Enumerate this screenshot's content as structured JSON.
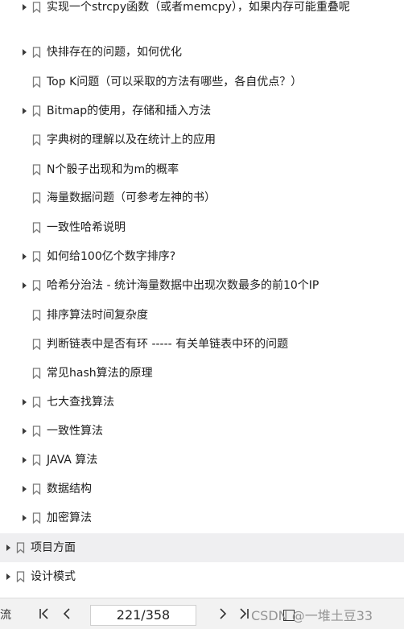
{
  "outline": {
    "items": [
      {
        "label": "实现一个strcpy函数（或者memcpy），如果内存可能重叠呢",
        "expandable": true,
        "level": 2
      },
      {
        "label": "快排存在的问题，如何优化",
        "expandable": true,
        "level": 2
      },
      {
        "label": "Top K问题（可以采取的方法有哪些，各自优点？）",
        "expandable": false,
        "level": 2
      },
      {
        "label": "Bitmap的使用，存储和插入方法",
        "expandable": true,
        "level": 2
      },
      {
        "label": "字典树的理解以及在统计上的应用",
        "expandable": false,
        "level": 2
      },
      {
        "label": "N个骰子出现和为m的概率",
        "expandable": false,
        "level": 2
      },
      {
        "label": "海量数据问题（可参考左神的书）",
        "expandable": false,
        "level": 2
      },
      {
        "label": "一致性哈希说明",
        "expandable": false,
        "level": 2
      },
      {
        "label": "如何给100亿个数字排序?",
        "expandable": true,
        "level": 2
      },
      {
        "label": "哈希分治法 - 统计海量数据中出现次数最多的前10个IP",
        "expandable": true,
        "level": 2
      },
      {
        "label": "排序算法时间复杂度",
        "expandable": false,
        "level": 2
      },
      {
        "label": "判断链表中是否有环 ----- 有关单链表中环的问题",
        "expandable": false,
        "level": 2
      },
      {
        "label": "常见hash算法的原理",
        "expandable": false,
        "level": 2
      },
      {
        "label": "七大查找算法",
        "expandable": true,
        "level": 2
      },
      {
        "label": "一致性算法",
        "expandable": true,
        "level": 2
      },
      {
        "label": "JAVA 算法",
        "expandable": true,
        "level": 2
      },
      {
        "label": "数据结构",
        "expandable": true,
        "level": 2
      },
      {
        "label": "加密算法",
        "expandable": true,
        "level": 2
      },
      {
        "label": "项目方面",
        "expandable": true,
        "level": 1,
        "selected": true
      },
      {
        "label": "设计模式",
        "expandable": true,
        "level": 1
      }
    ]
  },
  "bottombar": {
    "left_fragment": "流",
    "page_indicator": "221/358",
    "watermark": "CSDN @一堆土豆33"
  },
  "colors": {
    "selected_row": "#efeff1",
    "bookmark": "#7a7a7a",
    "bottombar": "#f2f2f2"
  }
}
